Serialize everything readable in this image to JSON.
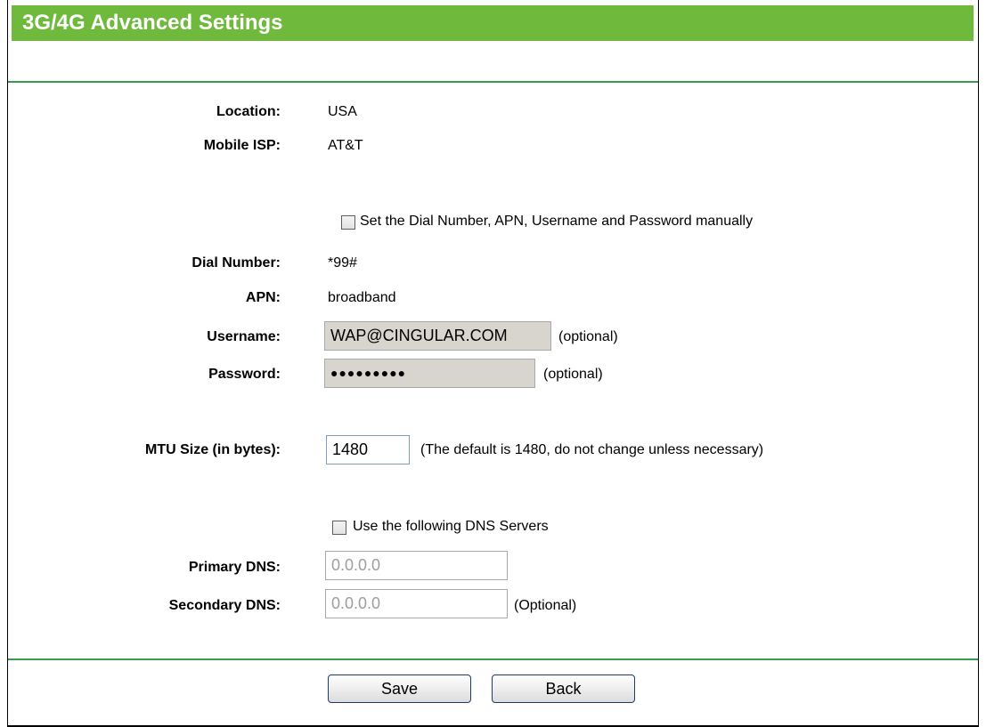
{
  "page": {
    "title": "3G/4G Advanced Settings"
  },
  "location": {
    "label": "Location:",
    "value": "USA"
  },
  "mobile_isp": {
    "label": "Mobile ISP:",
    "value": "AT&T"
  },
  "manual_checkbox": {
    "label": "Set the Dial Number, APN, Username and Password manually",
    "checked": false
  },
  "dial_number": {
    "label": "Dial Number:",
    "value": "*99#"
  },
  "apn": {
    "label": "APN:",
    "value": "broadband"
  },
  "username": {
    "label": "Username:",
    "value": "WAP@CINGULAR.COM",
    "note": "(optional)"
  },
  "password": {
    "label": "Password:",
    "value": "●●●●●●●●●",
    "note": "(optional)"
  },
  "mtu": {
    "label": "MTU Size (in bytes):",
    "value": "1480",
    "note": "(The default is 1480, do not change unless necessary)"
  },
  "dns_checkbox": {
    "label": "Use the following DNS Servers",
    "checked": false
  },
  "primary_dns": {
    "label": "Primary DNS:",
    "value": "0.0.0.0"
  },
  "secondary_dns": {
    "label": "Secondary DNS:",
    "value": "0.0.0.0",
    "note": "(Optional)"
  },
  "buttons": {
    "save": "Save",
    "back": "Back"
  },
  "colors": {
    "title_bar": "#6fb93d",
    "divider": "#3c9a4e"
  }
}
